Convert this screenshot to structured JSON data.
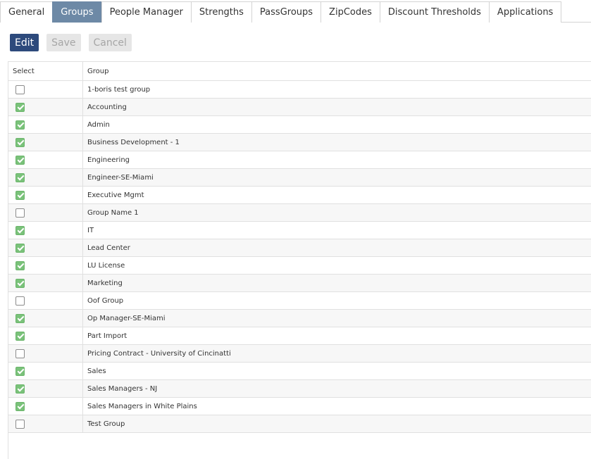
{
  "tabs": [
    {
      "label": "General",
      "active": false
    },
    {
      "label": "Groups",
      "active": true
    },
    {
      "label": "People Manager",
      "active": false
    },
    {
      "label": "Strengths",
      "active": false
    },
    {
      "label": "PassGroups",
      "active": false
    },
    {
      "label": "ZipCodes",
      "active": false
    },
    {
      "label": "Discount Thresholds",
      "active": false
    },
    {
      "label": "Applications",
      "active": false
    }
  ],
  "toolbar": {
    "edit_label": "Edit",
    "save_label": "Save",
    "cancel_label": "Cancel"
  },
  "grid": {
    "columns": {
      "select": "Select",
      "group": "Group"
    },
    "rows": [
      {
        "group": "1-boris test group",
        "selected": false
      },
      {
        "group": "Accounting",
        "selected": true
      },
      {
        "group": "Admin",
        "selected": true
      },
      {
        "group": "Business Development - 1",
        "selected": true
      },
      {
        "group": "Engineering",
        "selected": true
      },
      {
        "group": "Engineer-SE-Miami",
        "selected": true
      },
      {
        "group": "Executive Mgmt",
        "selected": true
      },
      {
        "group": "Group Name 1",
        "selected": false
      },
      {
        "group": "IT",
        "selected": true
      },
      {
        "group": "Lead Center",
        "selected": true
      },
      {
        "group": "LU License",
        "selected": true
      },
      {
        "group": "Marketing",
        "selected": true
      },
      {
        "group": "Oof Group",
        "selected": false
      },
      {
        "group": "Op Manager-SE-Miami",
        "selected": true
      },
      {
        "group": "Part Import",
        "selected": true
      },
      {
        "group": "Pricing Contract - University of Cincinatti",
        "selected": false
      },
      {
        "group": "Sales",
        "selected": true
      },
      {
        "group": "Sales Managers - NJ",
        "selected": true
      },
      {
        "group": "Sales Managers in White Plains",
        "selected": true
      },
      {
        "group": "Test Group",
        "selected": false
      }
    ]
  }
}
